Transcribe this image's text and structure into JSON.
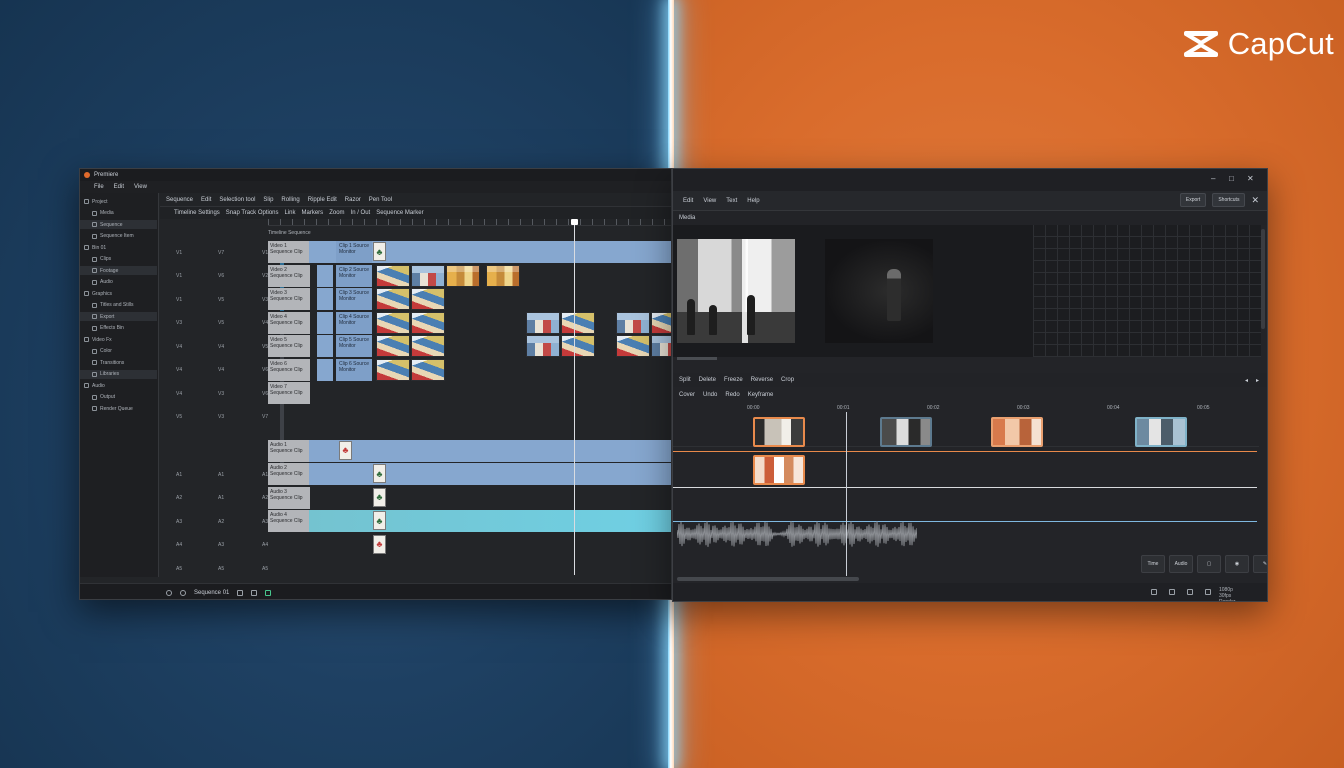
{
  "brand": {
    "name": "CapCut"
  },
  "left_window": {
    "title": "Premiere",
    "menu": [
      "File",
      "Edit",
      "View"
    ],
    "sidebar": [
      {
        "label": "Project",
        "highlight": false
      },
      {
        "label": "Media",
        "highlight": false
      },
      {
        "label": "Sequence",
        "highlight": true
      },
      {
        "label": "Sequence Item",
        "highlight": false
      },
      {
        "label": "Bin 01",
        "highlight": false
      },
      {
        "label": "Clips",
        "highlight": false
      },
      {
        "label": "Footage",
        "highlight": true
      },
      {
        "label": "Audio",
        "highlight": false
      },
      {
        "label": "Graphics",
        "highlight": false
      },
      {
        "label": "Titles and Stills",
        "highlight": false
      },
      {
        "label": "Export",
        "highlight": true
      },
      {
        "label": "Effects Bin",
        "highlight": false
      },
      {
        "label": "Video Fx",
        "highlight": false
      },
      {
        "label": "Color",
        "highlight": false
      },
      {
        "label": "Transitions",
        "highlight": false
      },
      {
        "label": "Libraries",
        "highlight": true
      },
      {
        "label": "Audio",
        "highlight": false
      },
      {
        "label": "Output",
        "highlight": false
      },
      {
        "label": "Render Queue",
        "highlight": false
      }
    ],
    "toolbar": [
      "Sequence",
      "Edit",
      "Selection tool",
      "Slip",
      "Rolling",
      "Ripple Edit",
      "Razor",
      "Pen Tool"
    ],
    "toolbar2": [
      "Timeline Settings",
      "Snap Track Options",
      "Link",
      "Markers",
      "Zoom",
      "In / Out",
      "Sequence Marker"
    ],
    "ruler_label": "Timeline Sequence",
    "tracks": [
      {
        "c1": "V1",
        "c2": "V7",
        "c3": "V1"
      },
      {
        "c1": "V1",
        "c2": "V6",
        "c3": "V2"
      },
      {
        "c1": "V1",
        "c2": "V5",
        "c3": "V3"
      },
      {
        "c1": "V3",
        "c2": "V5",
        "c3": "V4"
      },
      {
        "c1": "V4",
        "c2": "V4",
        "c3": "V5"
      },
      {
        "c1": "V4",
        "c2": "V4",
        "c3": "V6"
      },
      {
        "c1": "V4",
        "c2": "V3",
        "c3": "V6"
      },
      {
        "c1": "V5",
        "c2": "V3",
        "c3": "V7"
      },
      {
        "c1": "A1",
        "c2": "A1",
        "c3": "A1"
      },
      {
        "c1": "A2",
        "c2": "A1",
        "c3": "A2"
      },
      {
        "c1": "A3",
        "c2": "A2",
        "c3": "A3"
      },
      {
        "c1": "A4",
        "c2": "A3",
        "c3": "A4"
      },
      {
        "c1": "A5",
        "c2": "A5",
        "c3": "A5"
      }
    ],
    "clip_labels": [
      "Video 1 Sequence Clip",
      "Video 2 Sequence Clip",
      "Video 3 Sequence Clip",
      "Video 4 Sequence Clip",
      "Video 5 Sequence Clip",
      "Video 6 Sequence Clip",
      "Video 7 Sequence Clip",
      "Audio 1 Sequence Clip",
      "Audio 2 Sequence Clip",
      "Audio 3 Sequence Clip",
      "Audio 4 Sequence Clip"
    ],
    "blue_labels": [
      "Clip 1 Source Monitor",
      "Clip 2 Source Monitor",
      "Clip 3 Source Monitor",
      "Clip 4 Source Monitor",
      "Clip 5 Source Monitor",
      "Clip 6 Source Monitor"
    ],
    "footer_label": "Sequence 01"
  },
  "right_window": {
    "menu": [
      "Edit",
      "View",
      "Text",
      "Help"
    ],
    "actions": [
      "Export",
      "Shortcuts"
    ],
    "subbar": [
      "Media"
    ],
    "tools": [
      "Split",
      "Delete",
      "Freeze",
      "Reverse",
      "Crop"
    ],
    "tools2": [
      "Cover",
      "Undo",
      "Redo",
      "Keyframe"
    ],
    "ruler_labels": [
      "00:00",
      "00:01",
      "00:02",
      "00:03",
      "00:04",
      "00:05",
      "00:06"
    ],
    "bottom_buttons": [
      "Time",
      "Audio",
      "▢",
      "◉",
      "✎"
    ],
    "status_text": "1080p 30fps Render"
  }
}
